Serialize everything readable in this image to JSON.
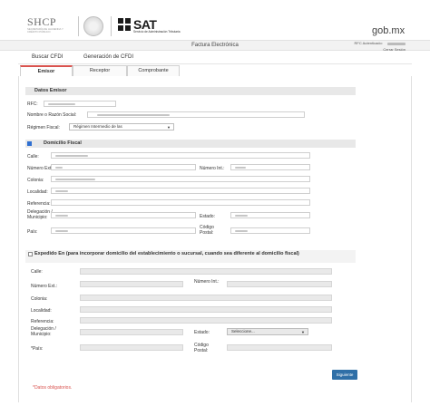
{
  "header": {
    "shcp_logo": "SHCP",
    "shcp_subtitle": "SECRETARÍA DE HACIENDA Y CRÉDITO PÚBLICO",
    "sat_logo": "SAT",
    "sat_subtitle": "Servicio de Administración Tributaria",
    "gob_logo": "gob.mx"
  },
  "topbar": {
    "title": "Factura Electrónica",
    "rfc_label": "RFC Autenticado:",
    "logout": "Cerrar Sesión"
  },
  "menu": {
    "items": [
      "Buscar CFDI",
      "Generación de CFDI"
    ]
  },
  "tabs": [
    {
      "label": "Emisor",
      "active": true
    },
    {
      "label": "Receptor",
      "active": false
    },
    {
      "label": "Comprobante",
      "active": false
    }
  ],
  "datos_emisor": {
    "title": "Datos Emisor",
    "rfc_label": "RFC:",
    "nombre_label": "Nombre o Razón Social:",
    "regimen_label": "Régimen Fiscal:",
    "regimen_value": "Régimen Intermedio de las"
  },
  "domicilio_fiscal": {
    "title": "Domicilio Fiscal",
    "checked": true,
    "calle": "Calle:",
    "numero_ext": "Número Ext.:",
    "numero_int": "Número Int.:",
    "colonia": "Colonia:",
    "localidad": "Localidad:",
    "referencia": "Referencia:",
    "delegacion": "Delegación / Municipio:",
    "estado": "Estado:",
    "pais": "País:",
    "codigo_postal": "Código Postal:"
  },
  "expedido": {
    "title": "Expedido En (para incorporar domicilio del establecimiento o sucursal, cuando sea diferente al domicilio fiscal)",
    "checked": false,
    "calle": "Calle:",
    "numero_ext": "Número Ext.:",
    "numero_int": "Número Int.:",
    "colonia": "Colonia:",
    "localidad": "Localidad:",
    "referencia": "Referencia:",
    "delegacion": "Delegación / Municipio:",
    "estado": "Estado:",
    "estado_value": "Seleccione...",
    "pais": "*País:",
    "codigo_postal": "Código Postal:"
  },
  "actions": {
    "next": "Siguiente"
  },
  "footer": {
    "required_note": "*Datos obligatorios."
  },
  "colors": {
    "accent_red": "#d9534f",
    "button_blue": "#2f6fa7",
    "checkbox_blue": "#2f6fd1"
  }
}
